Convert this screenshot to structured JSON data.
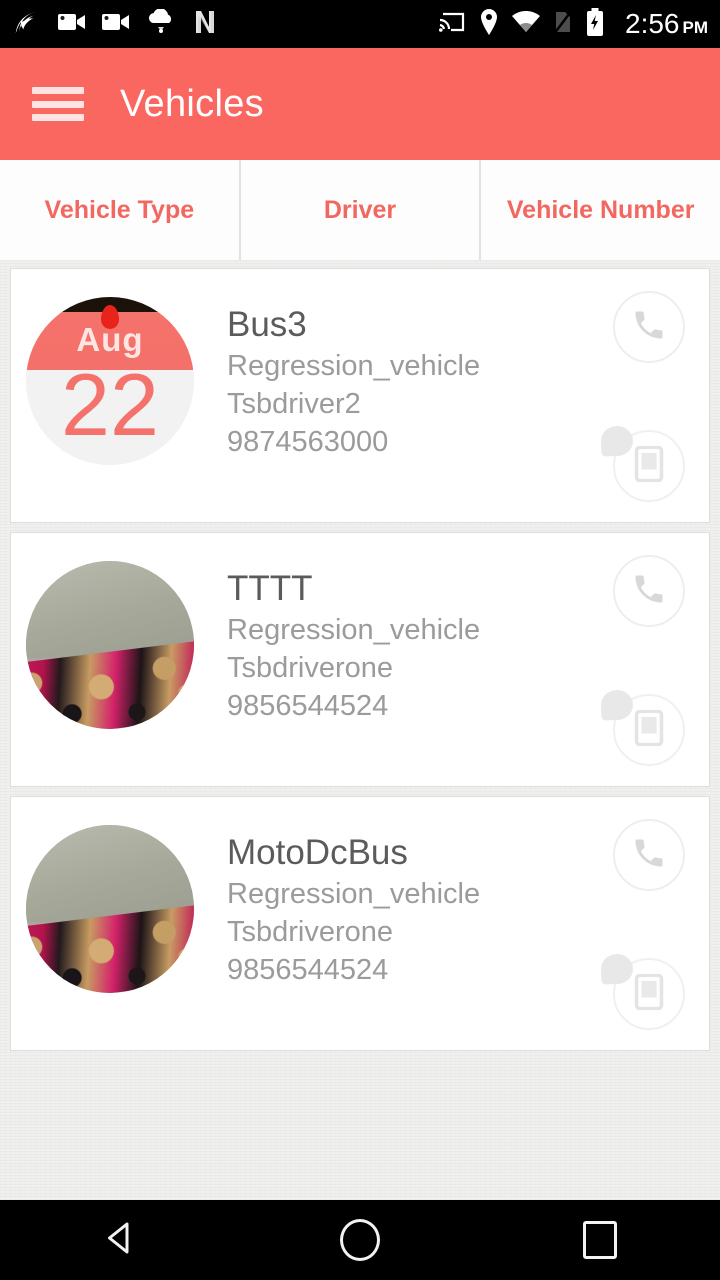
{
  "statusbar": {
    "icons_left": [
      "app-swirl-icon",
      "video-camera-icon",
      "video-camera-icon",
      "cloud-upload-icon",
      "netflix-n-icon"
    ],
    "icons_right": [
      "cast-icon",
      "location-pin-icon",
      "wifi-icon",
      "no-sim-icon",
      "battery-charging-icon"
    ],
    "time": "2:56",
    "ampm": "PM"
  },
  "appbar": {
    "menu_icon": "hamburger-menu-icon",
    "title": "Vehicles",
    "background_color": "#fa6660",
    "title_color": "#ffffff"
  },
  "tabs": {
    "accent_color": "#f2675f",
    "items": [
      {
        "label": "Vehicle Type"
      },
      {
        "label": "Driver"
      },
      {
        "label": "Vehicle Number"
      }
    ]
  },
  "list": {
    "cards": [
      {
        "avatar_type": "calendar",
        "avatar_month": "Aug",
        "avatar_day": "22",
        "title": "Bus3",
        "vehicle_type": "Regression_vehicle",
        "driver": "Tsbdriver2",
        "phone": "9874563000",
        "call_icon": "phone-handset-icon",
        "device_icon": "mobile-device-icon"
      },
      {
        "avatar_type": "photo",
        "title": "TTTT",
        "vehicle_type": "Regression_vehicle",
        "driver": "Tsbdriverone",
        "phone": "9856544524",
        "call_icon": "phone-handset-icon",
        "device_icon": "mobile-device-icon"
      },
      {
        "avatar_type": "photo",
        "title": "MotoDcBus",
        "vehicle_type": "Regression_vehicle",
        "driver": "Tsbdriverone",
        "phone": "9856544524",
        "call_icon": "phone-handset-icon",
        "device_icon": "mobile-device-icon"
      }
    ]
  },
  "navbar": {
    "back": "back-triangle-icon",
    "home": "home-circle-icon",
    "recents": "recents-square-icon"
  }
}
